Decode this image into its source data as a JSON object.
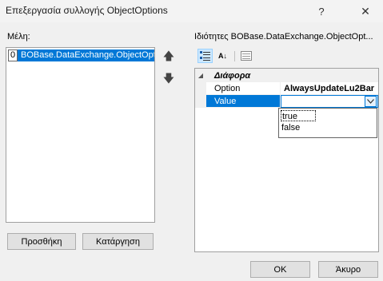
{
  "window": {
    "title": "Επεξεργασία συλλογής ObjectOptions",
    "help_label": "?",
    "close_label": "✕"
  },
  "members": {
    "label": "Μέλη:",
    "items": [
      {
        "index": "0",
        "text": "BOBase.DataExchange.ObjectOptions"
      }
    ],
    "add_label": "Προσθήκη",
    "remove_label": "Κατάργηση",
    "up_label": "🡅",
    "down_label": "🡇"
  },
  "properties": {
    "label": "Ιδιότητες BOBase.DataExchange.ObjectOpt...",
    "alpha_icon": "A↓",
    "category": "Διάφορα",
    "rows": [
      {
        "name": "Option",
        "value": "AlwaysUpdateLu2Bar"
      },
      {
        "name": "Value",
        "value": ""
      }
    ],
    "dropdown_options": [
      "true",
      "false"
    ]
  },
  "dialog": {
    "ok_label": "OK",
    "cancel_label": "Άκυρο"
  },
  "colors": {
    "accent": "#0078d7",
    "window_bg": "#f0f0f0"
  }
}
